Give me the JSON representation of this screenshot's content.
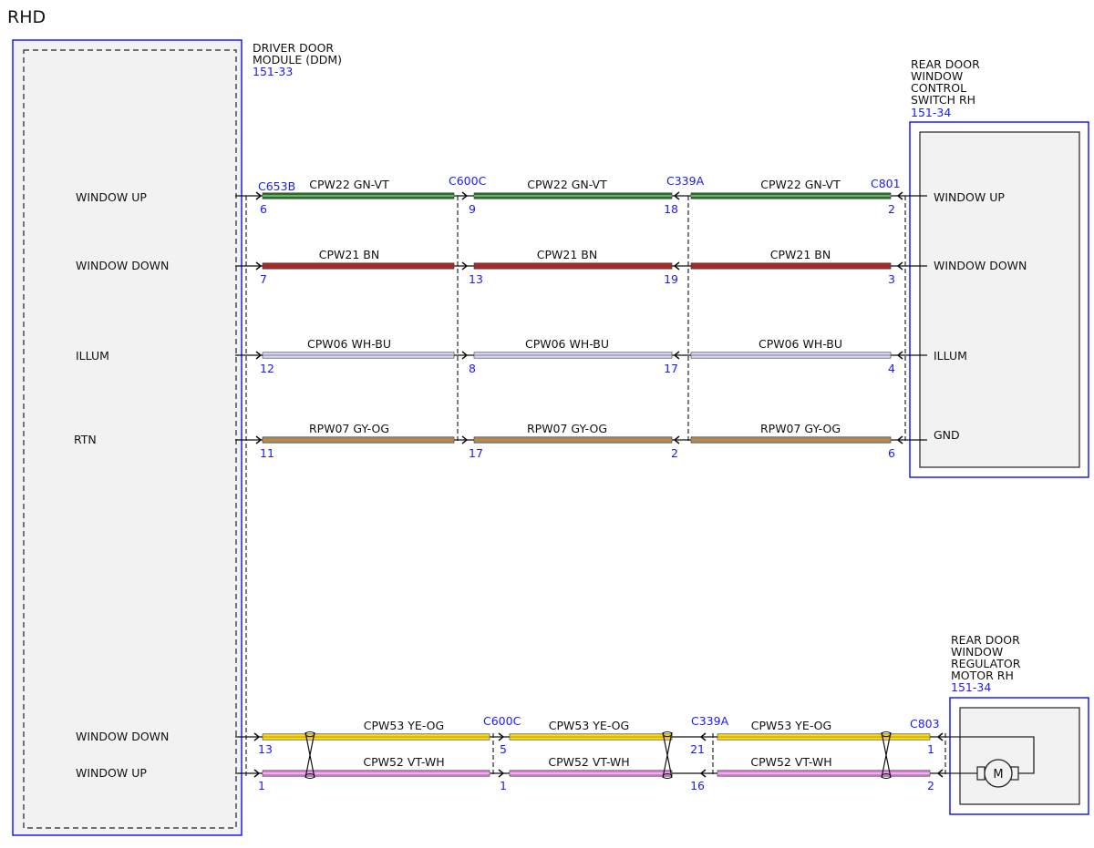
{
  "title": "RHD",
  "colors": {
    "blue": "#1a1aff",
    "box_fill": "#f2f2f2",
    "GN-VT": [
      "#2e6b2e",
      "#7fc97f"
    ],
    "BN": [
      "#a52a2a",
      "#a52a2a"
    ],
    "WH-BU": [
      "#d8d8ef",
      "#9999cc"
    ],
    "GY-OG": [
      "#9a8a6a",
      "#d6862a"
    ],
    "YE-OG": [
      "#f0e010",
      "#e6a020"
    ],
    "VT-WH": [
      "#d87ad8",
      "#f0c0f0"
    ]
  },
  "modules": {
    "ddm": {
      "name_lines": [
        "DRIVER DOOR",
        "MODULE (DDM)"
      ],
      "ref": "151-33",
      "pins": [
        "WINDOW UP",
        "WINDOW DOWN",
        "ILLUM",
        "RTN",
        "WINDOW DOWN",
        "WINDOW UP"
      ]
    },
    "switch": {
      "name_lines": [
        "REAR DOOR",
        "WINDOW",
        "CONTROL",
        "SWITCH RH"
      ],
      "ref": "151-34",
      "pins": [
        "WINDOW UP",
        "WINDOW DOWN",
        "ILLUM",
        "GND"
      ]
    },
    "motor": {
      "name_lines": [
        "REAR DOOR",
        "WINDOW",
        "REGULATOR",
        "MOTOR RH"
      ],
      "ref": "151-34",
      "symbol": "M"
    }
  },
  "connectors_top": [
    "C653B",
    "C600C",
    "C339A",
    "C801"
  ],
  "connectors_bottom": [
    "C600C",
    "C339A",
    "C803"
  ],
  "circuits_top": [
    {
      "circuit": "CPW22",
      "color": "GN-VT",
      "pins": [
        "6",
        "9",
        "18",
        "2"
      ]
    },
    {
      "circuit": "CPW21",
      "color": "BN",
      "pins": [
        "7",
        "13",
        "19",
        "3"
      ]
    },
    {
      "circuit": "CPW06",
      "color": "WH-BU",
      "pins": [
        "12",
        "8",
        "17",
        "4"
      ]
    },
    {
      "circuit": "RPW07",
      "color": "GY-OG",
      "pins": [
        "11",
        "17",
        "2",
        "6"
      ]
    }
  ],
  "circuits_bottom": [
    {
      "circuit": "CPW53",
      "color": "YE-OG",
      "pins": [
        "13",
        "5",
        "21",
        "1"
      ]
    },
    {
      "circuit": "CPW52",
      "color": "VT-WH",
      "pins": [
        "1",
        "1",
        "16",
        "2"
      ]
    }
  ]
}
